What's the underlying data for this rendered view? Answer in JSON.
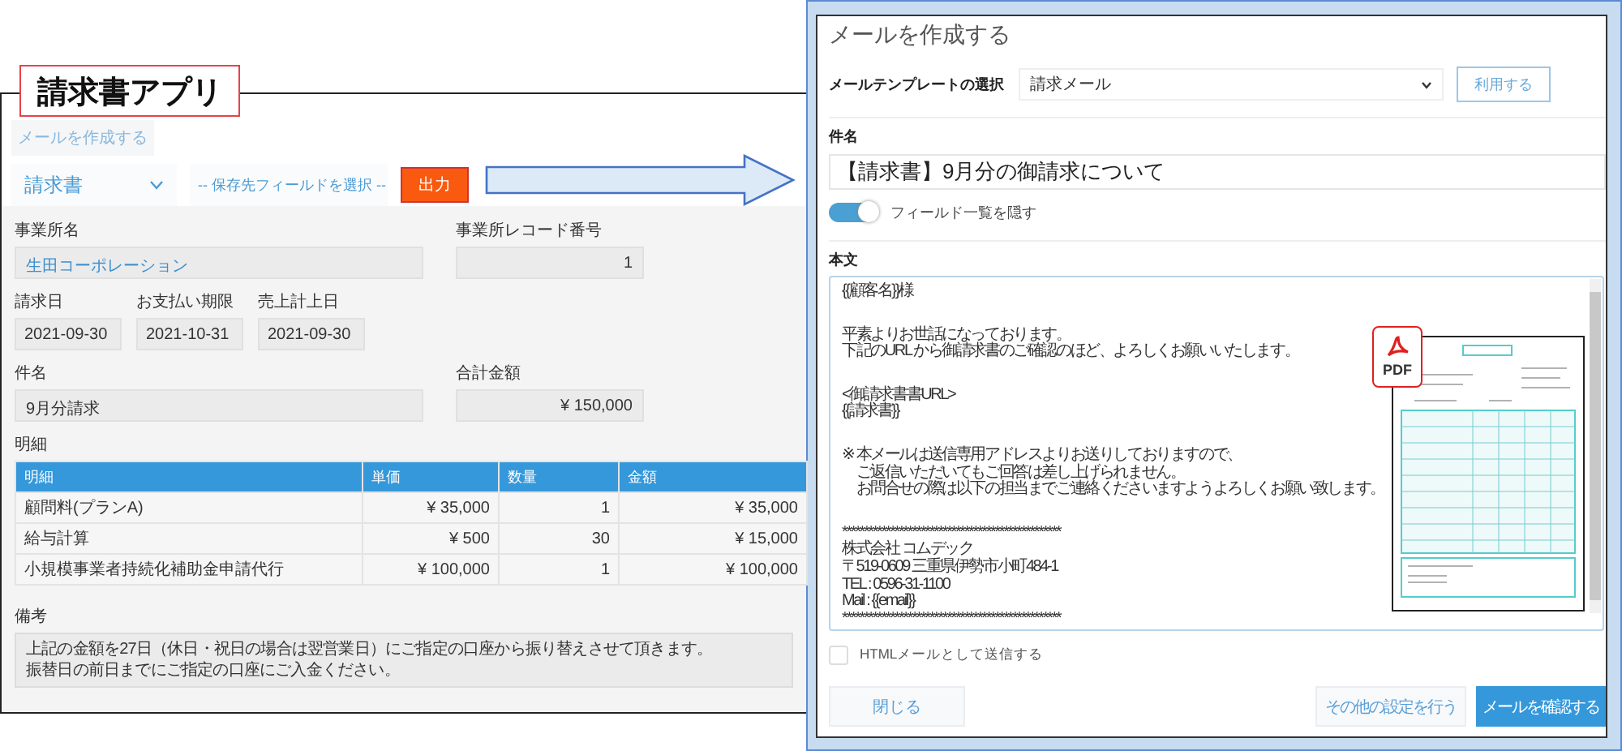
{
  "left_app": {
    "title": "請求書アプリ",
    "compose_button": "メールを作成する",
    "template_select": "請求書",
    "field_select": "-- 保存先フィールドを選択 --",
    "output_button": "出力",
    "field_rows": [
      [
        {
          "label": "事業所名",
          "value": "生田コーポレーション",
          "kind": "link"
        },
        {
          "label": "事業所レコード番号",
          "value": "1",
          "kind": "number"
        }
      ],
      [
        {
          "label": "請求日",
          "value": "2021-09-30",
          "kind": "date"
        },
        {
          "label": "お支払い期限",
          "value": "2021-10-31",
          "kind": "date"
        },
        {
          "label": "売上計上日",
          "value": "2021-09-30",
          "kind": "date"
        }
      ],
      [
        {
          "label": "件名",
          "value": "9月分請求",
          "kind": "text"
        },
        {
          "label": "合計金額",
          "value": "¥ 150,000",
          "kind": "number"
        }
      ]
    ],
    "table_label": "明細",
    "table": {
      "columns": [
        "明細",
        "単価",
        "数量",
        "金額"
      ],
      "rows": [
        [
          "顧問料(プランA)",
          "¥ 35,000",
          "1",
          "¥ 35,000"
        ],
        [
          "給与計算",
          "¥ 500",
          "30",
          "¥ 15,000"
        ],
        [
          "小規模事業者持続化補助金申請代行",
          "¥ 100,000",
          "1",
          "¥ 100,000"
        ]
      ]
    },
    "remarks_label": "備考",
    "remarks": [
      "上記の金額を27日（休日・祝日の場合は翌営業日）にご指定の口座から振り替えさせて頂きます。",
      "振替日の前日までにご指定の口座にご入金ください。"
    ]
  },
  "mail_dialog": {
    "title": "メールを作成する",
    "template_label": "メールテンプレートの選択",
    "template_value": "請求メール",
    "use_button": "利用する",
    "subject_label": "件名",
    "subject_value": "【請求書】9月分の御請求について",
    "toggle": {
      "label": "フィールド一覧を隠す",
      "on": true
    },
    "body_label": "本文",
    "body": [
      [
        "{{顧客名}}様"
      ],
      [
        "平素よりお世話になっております。",
        "下記のURL から御請求書のご確認のほど、よろしくお願いいたします。"
      ],
      [
        "<御請求書書URL>",
        "{{請求書}}"
      ],
      [
        "※ 本メールは送信専用アドレスよりお送りしておりますので、",
        "　ご返信いただいてもご回答は差し上げられません。",
        "　お問合せの際は以下の担当までご連絡くださいますようよろしくお願い致します。"
      ],
      [
        "**************************************************",
        "株式会社 コムデック",
        "〒519-0609 三重県伊勢市小町484-1",
        "TEL : 0596-31-1100",
        "Mail : {{email}}",
        "**************************************************"
      ]
    ],
    "attachment_badge": "PDF",
    "html_checkbox": {
      "label": "HTMLメールとして送信する",
      "checked": false
    },
    "close_button": "閉じる",
    "settings_button": "その他の設定を行う",
    "confirm_button": "メールを確認する"
  }
}
